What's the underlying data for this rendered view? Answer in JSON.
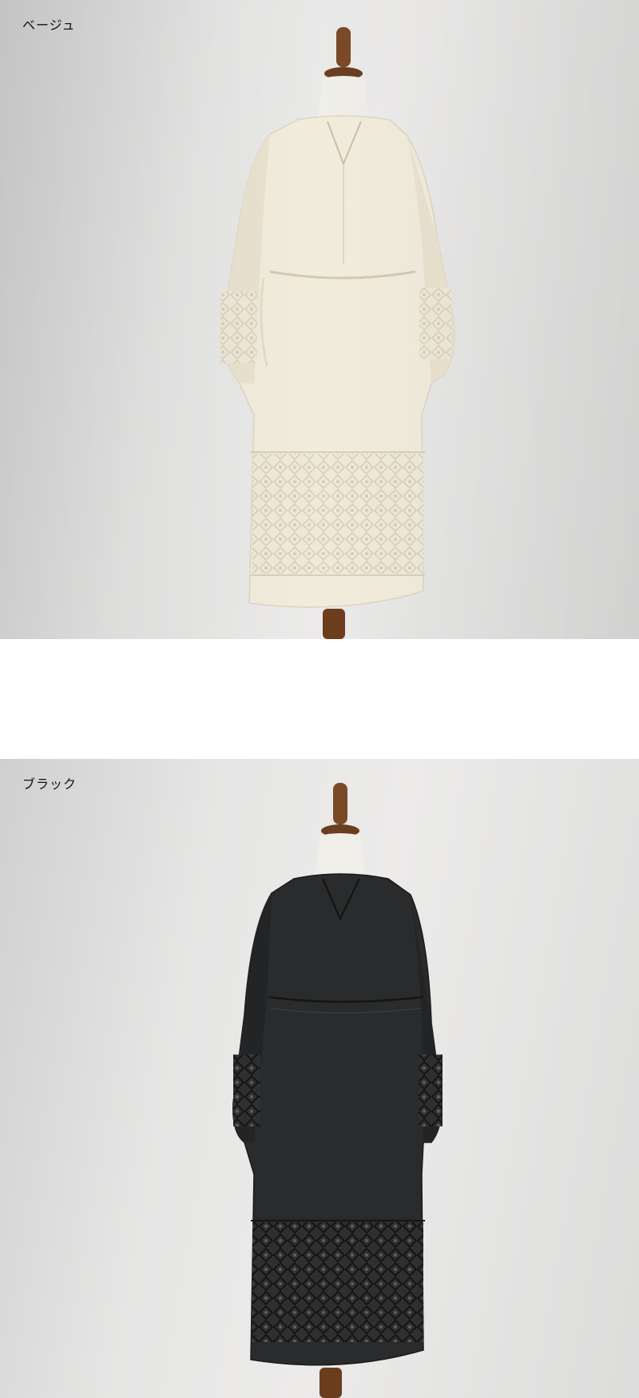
{
  "colors": {
    "background": "#ffffff",
    "beige_dress": "#f1ecdc",
    "black_dress": "#2a2b2c",
    "mannequin_wood": "#7a4a26",
    "mannequin_neck": "#efeee9"
  },
  "sections": [
    {
      "label": "ベージュ",
      "dress_color": "#f1ecdc"
    },
    {
      "label": "ブラック",
      "dress_color": "#2a2b2c"
    }
  ]
}
